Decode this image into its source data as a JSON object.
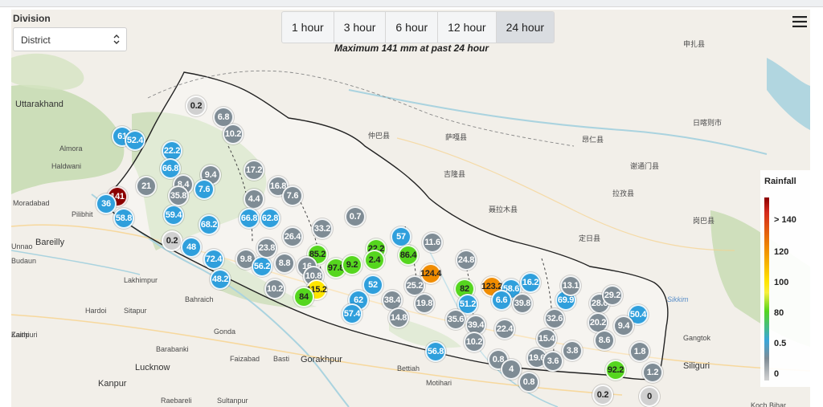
{
  "controls": {
    "division_label": "Division",
    "district_placeholder": "District",
    "time_tabs": [
      {
        "label": "1 hour",
        "active": false
      },
      {
        "label": "3 hour",
        "active": false
      },
      {
        "label": "6 hour",
        "active": false
      },
      {
        "label": "12 hour",
        "active": false
      },
      {
        "label": "24 hour",
        "active": true
      }
    ],
    "subtitle": "Maximum 141 mm at past 24 hour",
    "menu_icon": "hamburger-menu-icon",
    "chevron_icon": "up-down-chevron-icon"
  },
  "legend": {
    "title": "Rainfall",
    "ticks": [
      "> 140",
      "120",
      "100",
      "80",
      "0.5",
      "0"
    ]
  },
  "colors": {
    "extreme": "#8b0000",
    "heavy": "#f08c00",
    "high": "#ffe500",
    "moderate": "#55d61e",
    "light": "#2f9fdc",
    "trace": "#7f8c95",
    "none": "#d0d0d0",
    "land": "#f2efe9",
    "forest": "#c6dbb0",
    "water": "#aad3df"
  },
  "places": [
    {
      "name": "Uttarakhand",
      "style": "big"
    },
    {
      "name": "Almora",
      "style": ""
    },
    {
      "name": "Haldwani",
      "style": ""
    },
    {
      "name": "Moradabad",
      "style": ""
    },
    {
      "name": "Pilibhit",
      "style": ""
    },
    {
      "name": "Bareilly",
      "style": "big"
    },
    {
      "name": "Budaun",
      "style": ""
    },
    {
      "name": "Lakhimpur",
      "style": ""
    },
    {
      "name": "Hardoi",
      "style": ""
    },
    {
      "name": "Sitapur",
      "style": ""
    },
    {
      "name": "Bahraich",
      "style": ""
    },
    {
      "name": "Gonda",
      "style": ""
    },
    {
      "name": "Barabanki",
      "style": ""
    },
    {
      "name": "Lucknow",
      "style": "big"
    },
    {
      "name": "Faizabad",
      "style": ""
    },
    {
      "name": "Basti",
      "style": ""
    },
    {
      "name": "Gorakhpur",
      "style": "big"
    },
    {
      "name": "Kanpur",
      "style": "big"
    },
    {
      "name": "Raebareli",
      "style": ""
    },
    {
      "name": "Sultanpur",
      "style": ""
    },
    {
      "name": "Bettiah",
      "style": ""
    },
    {
      "name": "Motihari",
      "style": ""
    },
    {
      "name": "Sikkim",
      "style": "river"
    },
    {
      "name": "Gangtok",
      "style": ""
    },
    {
      "name": "Siliguri",
      "style": "big"
    },
    {
      "name": "Koch Bihar",
      "style": ""
    },
    {
      "name": "Unnao",
      "style": ""
    },
    {
      "name": "Kaithi",
      "style": ""
    },
    {
      "name": "Zainpuri",
      "style": ""
    },
    {
      "name": "仲巴县",
      "style": ""
    },
    {
      "name": "萨嘎县",
      "style": ""
    },
    {
      "name": "吉隆县",
      "style": ""
    },
    {
      "name": "聂拉木县",
      "style": ""
    },
    {
      "name": "昂仁县",
      "style": ""
    },
    {
      "name": "谢通门县",
      "style": ""
    },
    {
      "name": "拉孜县",
      "style": ""
    },
    {
      "name": "定日县",
      "style": ""
    },
    {
      "name": "日喀则市",
      "style": ""
    },
    {
      "name": "岗巴县",
      "style": ""
    },
    {
      "name": "申扎县",
      "style": ""
    }
  ],
  "stations": [
    {
      "v": "141",
      "c": "#8b0000"
    },
    {
      "v": "61",
      "c": "#2f9fdc"
    },
    {
      "v": "52.4",
      "c": "#2f9fdc"
    },
    {
      "v": "0.2",
      "c": "#d0d0d0"
    },
    {
      "v": "6.8",
      "c": "#7f8c95"
    },
    {
      "v": "10.2",
      "c": "#7f8c95"
    },
    {
      "v": "22.2",
      "c": "#2f9fdc"
    },
    {
      "v": "66.8",
      "c": "#2f9fdc"
    },
    {
      "v": "21",
      "c": "#7f8c95"
    },
    {
      "v": "8.4",
      "c": "#7f8c95"
    },
    {
      "v": "9.4",
      "c": "#7f8c95"
    },
    {
      "v": "17.2",
      "c": "#7f8c95"
    },
    {
      "v": "16.8",
      "c": "#7f8c95"
    },
    {
      "v": "7.6",
      "c": "#7f8c95"
    },
    {
      "v": "4.4",
      "c": "#7f8c95"
    },
    {
      "v": "36",
      "c": "#2f9fdc"
    },
    {
      "v": "58.8",
      "c": "#2f9fdc"
    },
    {
      "v": "59.4",
      "c": "#2f9fdc"
    },
    {
      "v": "35.8",
      "c": "#7f8c95"
    },
    {
      "v": "7.6",
      "c": "#2f9fdc"
    },
    {
      "v": "68.2",
      "c": "#2f9fdc"
    },
    {
      "v": "66.8",
      "c": "#2f9fdc"
    },
    {
      "v": "62.8",
      "c": "#2f9fdc"
    },
    {
      "v": "0.7",
      "c": "#7f8c95"
    },
    {
      "v": "0.2",
      "c": "#d0d0d0"
    },
    {
      "v": "48",
      "c": "#2f9fdc"
    },
    {
      "v": "72.4",
      "c": "#2f9fdc"
    },
    {
      "v": "48.2",
      "c": "#2f9fdc"
    },
    {
      "v": "9.8",
      "c": "#7f8c95"
    },
    {
      "v": "56.2",
      "c": "#2f9fdc"
    },
    {
      "v": "23.8",
      "c": "#7f8c95"
    },
    {
      "v": "26.4",
      "c": "#7f8c95"
    },
    {
      "v": "33.2",
      "c": "#7f8c95"
    },
    {
      "v": "85.2",
      "c": "#55d61e"
    },
    {
      "v": "22.2",
      "c": "#55d61e"
    },
    {
      "v": "57",
      "c": "#2f9fdc"
    },
    {
      "v": "11.6",
      "c": "#7f8c95"
    },
    {
      "v": "86.4",
      "c": "#55d61e"
    },
    {
      "v": "97.8",
      "c": "#55d61e"
    },
    {
      "v": "9.2",
      "c": "#55d61e"
    },
    {
      "v": "2.4",
      "c": "#55d61e"
    },
    {
      "v": "16",
      "c": "#7f8c95"
    },
    {
      "v": "8.8",
      "c": "#7f8c95"
    },
    {
      "v": "10.2",
      "c": "#7f8c95"
    },
    {
      "v": "10.8",
      "c": "#7f8c95"
    },
    {
      "v": "115.2",
      "c": "#ffe500"
    },
    {
      "v": "84",
      "c": "#55d61e"
    },
    {
      "v": "52",
      "c": "#2f9fdc"
    },
    {
      "v": "62",
      "c": "#2f9fdc"
    },
    {
      "v": "57.4",
      "c": "#2f9fdc"
    },
    {
      "v": "38.4",
      "c": "#7f8c95"
    },
    {
      "v": "14.8",
      "c": "#7f8c95"
    },
    {
      "v": "25.2",
      "c": "#7f8c95"
    },
    {
      "v": "19.8",
      "c": "#7f8c95"
    },
    {
      "v": "124.4",
      "c": "#f08c00"
    },
    {
      "v": "24.8",
      "c": "#7f8c95"
    },
    {
      "v": "82",
      "c": "#55d61e"
    },
    {
      "v": "51.2",
      "c": "#2f9fdc"
    },
    {
      "v": "123.2",
      "c": "#f08c00"
    },
    {
      "v": "58.6",
      "c": "#2f9fdc"
    },
    {
      "v": "6.6",
      "c": "#2f9fdc"
    },
    {
      "v": "16.2",
      "c": "#2f9fdc"
    },
    {
      "v": "39.8",
      "c": "#7f8c95"
    },
    {
      "v": "35.6",
      "c": "#7f8c95"
    },
    {
      "v": "39.4",
      "c": "#7f8c95"
    },
    {
      "v": "22.4",
      "c": "#7f8c95"
    },
    {
      "v": "10.2",
      "c": "#7f8c95"
    },
    {
      "v": "56.8",
      "c": "#2f9fdc"
    },
    {
      "v": "0.8",
      "c": "#7f8c95"
    },
    {
      "v": "4",
      "c": "#7f8c95"
    },
    {
      "v": "0.8",
      "c": "#7f8c95"
    },
    {
      "v": "19.6",
      "c": "#7f8c95"
    },
    {
      "v": "3.6",
      "c": "#7f8c95"
    },
    {
      "v": "3.8",
      "c": "#7f8c95"
    },
    {
      "v": "15.4",
      "c": "#7f8c95"
    },
    {
      "v": "32.6",
      "c": "#7f8c95"
    },
    {
      "v": "69.9",
      "c": "#2f9fdc"
    },
    {
      "v": "13.1",
      "c": "#7f8c95"
    },
    {
      "v": "28.6",
      "c": "#7f8c95"
    },
    {
      "v": "29.2",
      "c": "#7f8c95"
    },
    {
      "v": "50.4",
      "c": "#2f9fdc"
    },
    {
      "v": "20.2",
      "c": "#7f8c95"
    },
    {
      "v": "9.4",
      "c": "#7f8c95"
    },
    {
      "v": "8.6",
      "c": "#7f8c95"
    },
    {
      "v": "1.8",
      "c": "#7f8c95"
    },
    {
      "v": "92.2",
      "c": "#55d61e"
    },
    {
      "v": "1.2",
      "c": "#7f8c95"
    },
    {
      "v": "0.2",
      "c": "#d0d0d0"
    },
    {
      "v": "0",
      "c": "#d0d0d0"
    }
  ]
}
